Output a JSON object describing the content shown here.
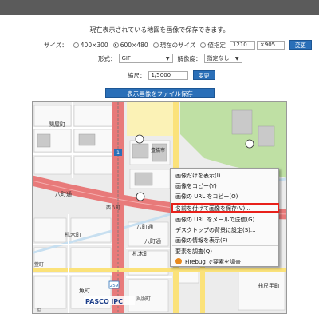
{
  "notice": "現在表示されている地図を画像で保存できます。",
  "size_row": {
    "label": "サイズ：",
    "options": [
      "400×300",
      "600×480",
      "現在のサイズ",
      "値指定"
    ],
    "selected_index": 1,
    "width_value": "1210",
    "height_value": "×905",
    "change_label": "変更"
  },
  "format_row": {
    "format_label": "形式：",
    "format_value": "GIF",
    "resolution_label": "解像度：",
    "resolution_value": "指定なし"
  },
  "scale_row": {
    "label": "縮尺：",
    "value": "1/5000",
    "change_label": "変更"
  },
  "save_button": "表示画像をファイル保存",
  "map": {
    "labels": [
      "関屋町",
      "八町通",
      "八町通",
      "札木町",
      "札木町",
      "八町通",
      "魚町",
      "曲尺手町",
      "西八町",
      "豊橋市",
      "呉服町",
      "萱町"
    ],
    "route_numbers": [
      "1",
      "1",
      "259"
    ],
    "logo": "PASCO iPC",
    "copyright": "©"
  },
  "context_menu": {
    "items": [
      "画像だけを表示(I)",
      "画像をコピー(Y)",
      "画像の URL をコピー(O)",
      "名前を付けて画像を保存(V)...",
      "画像の URL をメールで送信(G)...",
      "デスクトップの背景に設定(S)...",
      "画像の情報を表示(F)",
      "要素を調査(Q)",
      "Firebug で要素を調査"
    ],
    "highlighted_index": 3
  }
}
